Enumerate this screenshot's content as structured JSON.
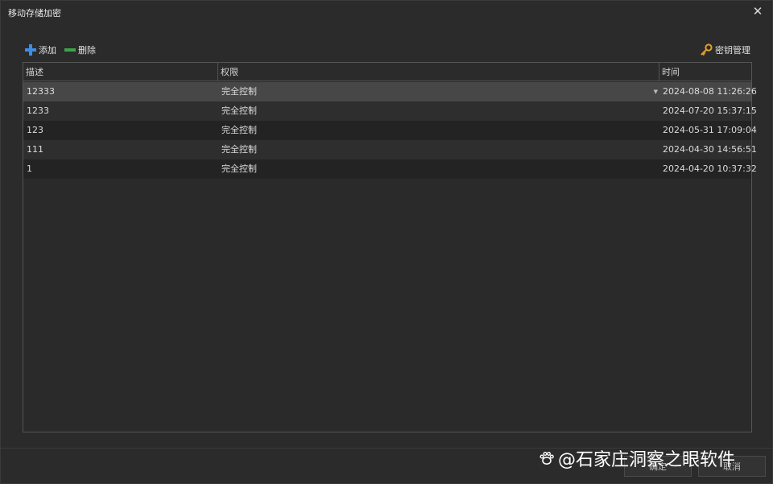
{
  "window": {
    "title": "移动存储加密",
    "close_glyph": "✕"
  },
  "toolbar": {
    "add_label": "添加",
    "add_icon": "plus-icon",
    "delete_label": "删除",
    "delete_icon": "minus-icon",
    "key_label": "密钥管理",
    "key_icon": "key-icon"
  },
  "table": {
    "columns": [
      "描述",
      "权限",
      "时间"
    ],
    "rows": [
      {
        "desc": "12333",
        "perm": "完全控制",
        "time": "2024-08-08 11:26:26",
        "selected": true
      },
      {
        "desc": "1233",
        "perm": "完全控制",
        "time": "2024-07-20 15:37:15"
      },
      {
        "desc": "123",
        "perm": "完全控制",
        "time": "2024-05-31 17:09:04"
      },
      {
        "desc": "111",
        "perm": "完全控制",
        "time": "2024-04-30 14:56:51"
      },
      {
        "desc": "1",
        "perm": "完全控制",
        "time": "2024-04-20 10:37:32"
      }
    ]
  },
  "footer": {
    "ok_label": "确定",
    "cancel_label": "取消"
  },
  "watermark": {
    "text": "@石家庄洞察之眼软件"
  },
  "colors": {
    "background": "#2b2b2b",
    "selected_row": "#474747",
    "add_icon": "#3b8ee8",
    "delete_icon": "#3fa34a",
    "key_icon": "#e0a030"
  }
}
